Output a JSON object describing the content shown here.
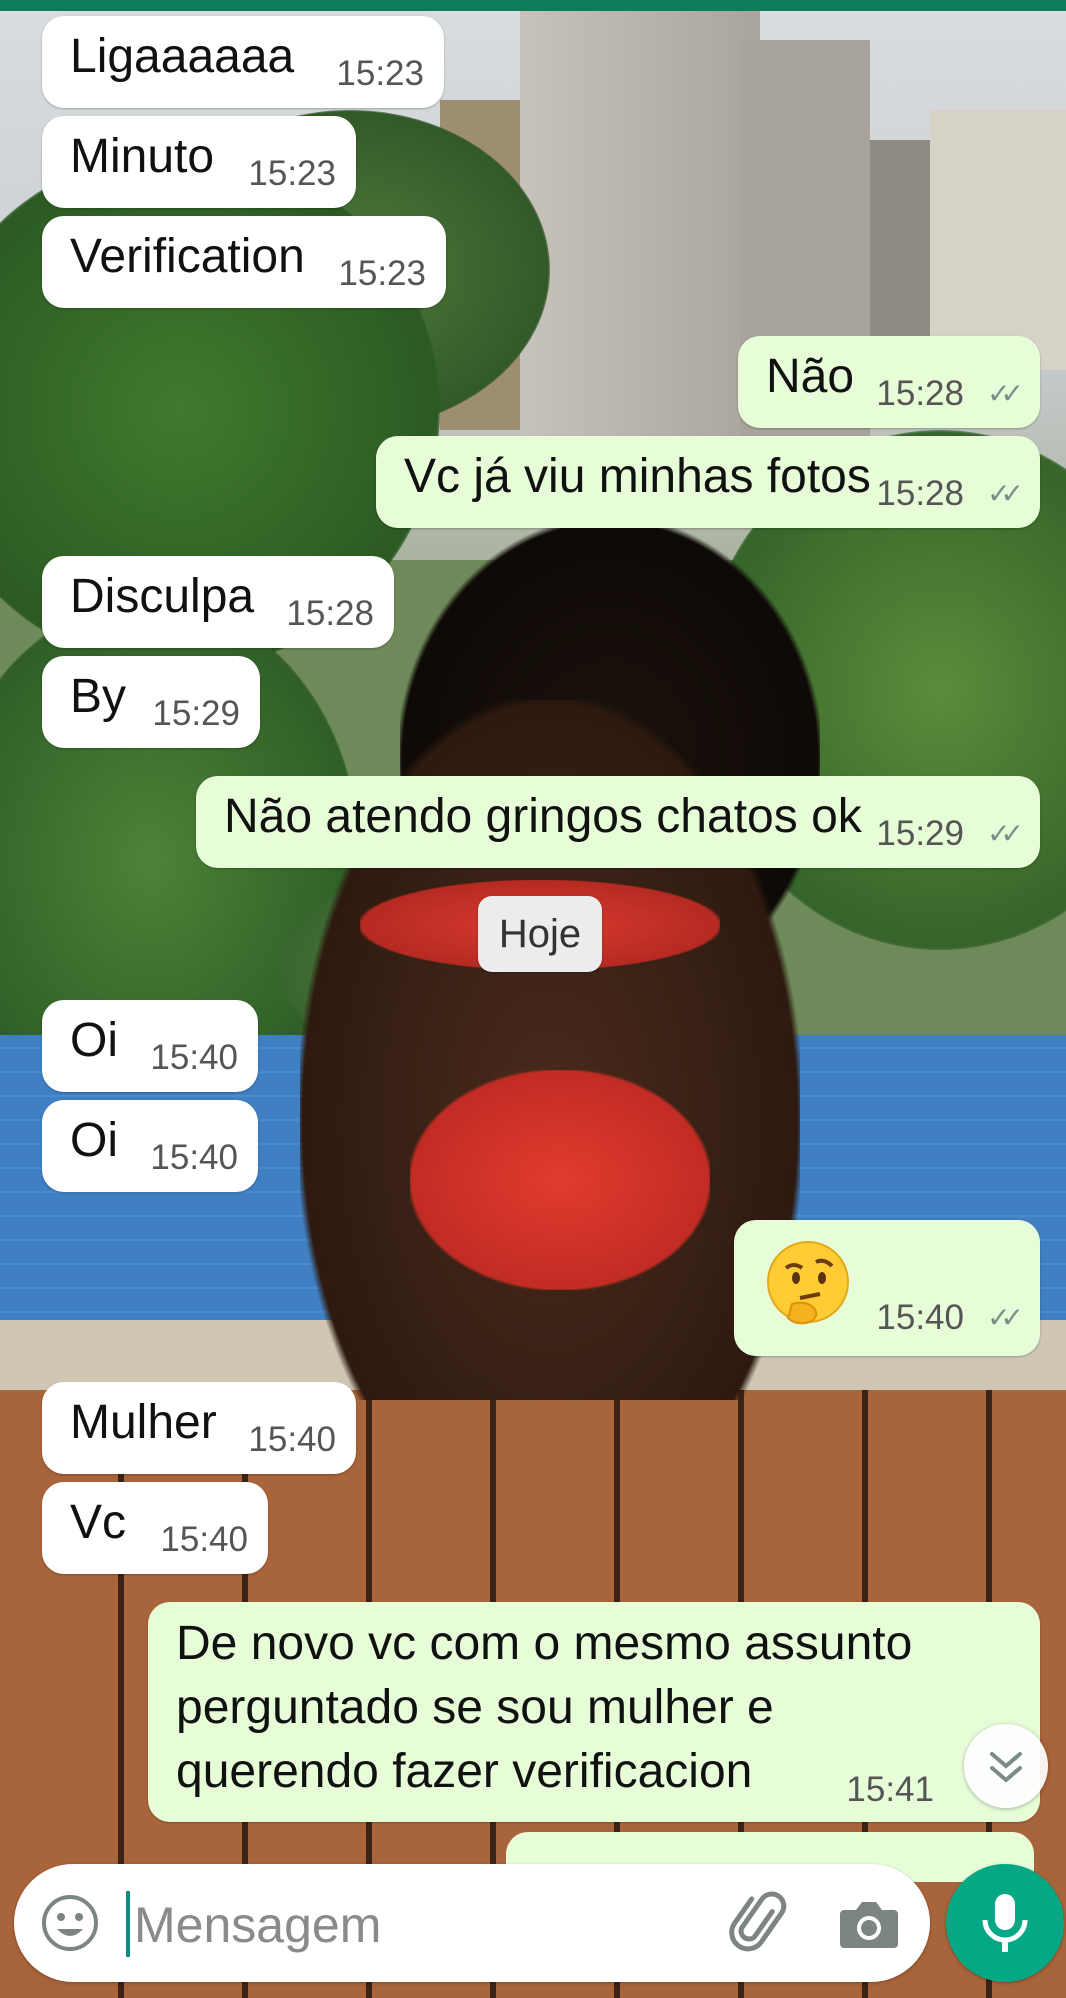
{
  "composer": {
    "placeholder": "Mensagem",
    "emoji_icon": "smiley-icon",
    "attach_icon": "paperclip-icon",
    "camera_icon": "camera-icon",
    "mic_icon": "microphone-icon"
  },
  "date_divider": "Hoje",
  "messages": [
    {
      "dir": "in",
      "text": "Ligaaaaaa",
      "time": "15:23"
    },
    {
      "dir": "in",
      "text": "Minuto",
      "time": "15:23"
    },
    {
      "dir": "in",
      "text": "Verification",
      "time": "15:23"
    },
    {
      "dir": "out",
      "text": "Não",
      "time": "15:28",
      "status": "read"
    },
    {
      "dir": "out",
      "text": "Vc já viu minhas fotos",
      "time": "15:28",
      "status": "read"
    },
    {
      "dir": "in",
      "text": "Disculpa",
      "time": "15:28"
    },
    {
      "dir": "in",
      "text": "By",
      "time": "15:29"
    },
    {
      "dir": "out",
      "text": "Não atendo gringos chatos ok",
      "time": "15:29",
      "status": "read"
    },
    {
      "dir": "in",
      "text": "Oi",
      "time": "15:40"
    },
    {
      "dir": "in",
      "text": "Oi",
      "time": "15:40"
    },
    {
      "dir": "out",
      "text": "",
      "emoji": "thinking-face-emoji",
      "time": "15:40",
      "status": "read"
    },
    {
      "dir": "in",
      "text": "Mulher",
      "time": "15:40"
    },
    {
      "dir": "in",
      "text": "Vc",
      "time": "15:40"
    },
    {
      "dir": "out",
      "text": "De novo vc com o mesmo assunto perguntado se sou mulher e querendo fazer verificacion",
      "time": "15:41"
    }
  ],
  "colors": {
    "outgoing_bubble": "#e7fdd8",
    "incoming_bubble": "#ffffff",
    "accent": "#05a884",
    "status_bar": "#0f7a5c"
  }
}
